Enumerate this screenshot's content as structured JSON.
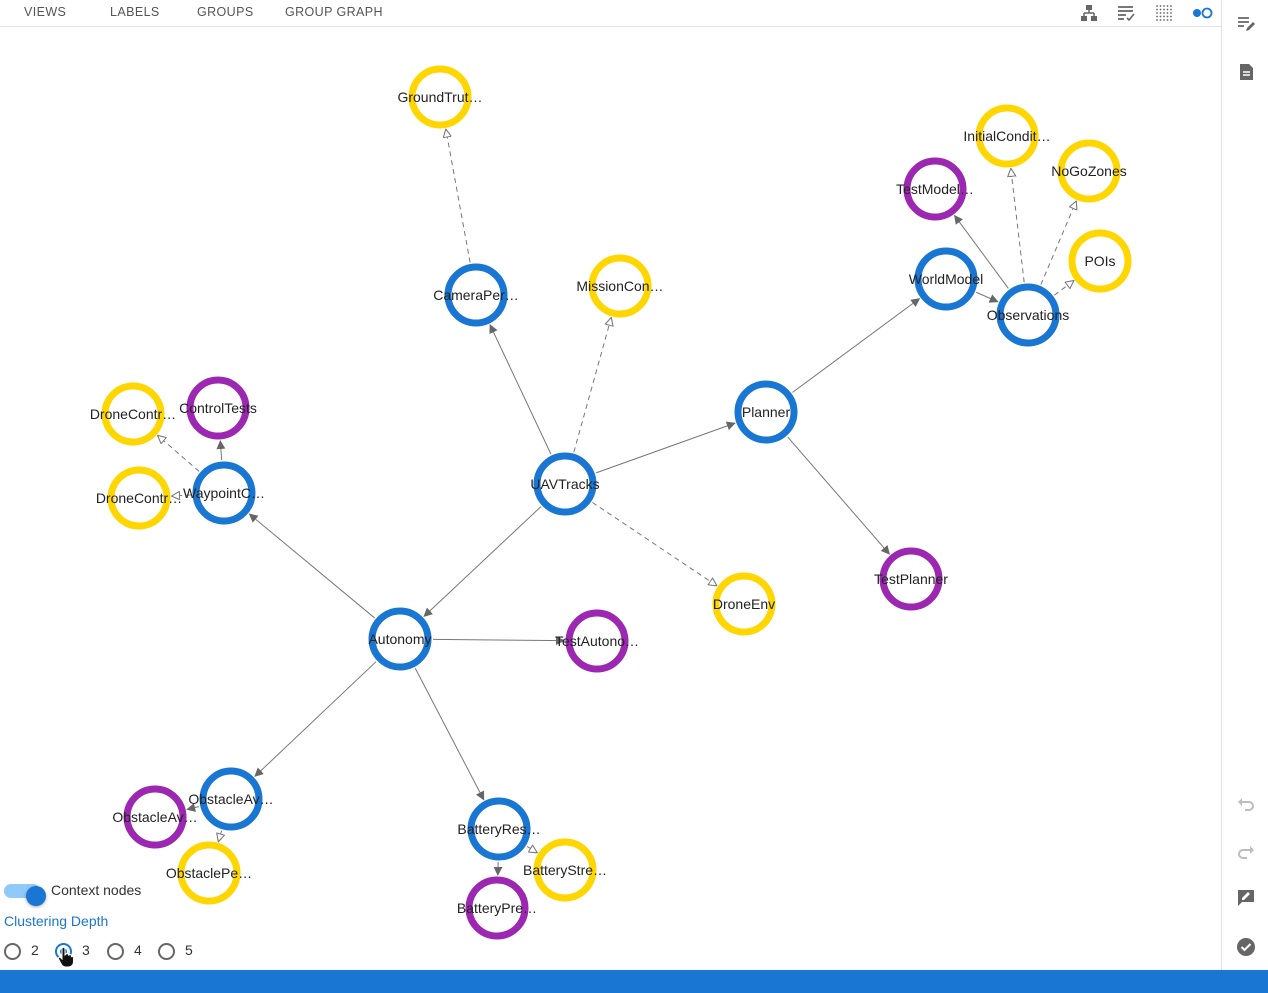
{
  "tabs": [
    "VIEWS",
    "LABELS",
    "GROUPS",
    "GROUP GRAPH"
  ],
  "toolbar_icons": [
    "hierarchy-icon",
    "list-check-icon",
    "dot-grid-icon",
    "node-toggle-icon"
  ],
  "sidebar_icons": [
    "edit-list-icon",
    "document-icon",
    "undo-icon",
    "redo-icon",
    "feedback-icon",
    "check-circle-icon"
  ],
  "colors": {
    "blue": "#1976d2",
    "yellow": "#ffd600",
    "purple": "#9c27b0",
    "accent": "#1976d2",
    "bottom_bar": "#1976d2",
    "toggle_track": "#90caf9",
    "edge": "#777777"
  },
  "graph": {
    "nodes": [
      {
        "id": "uav",
        "label": "UAVTracks",
        "color": "blue"
      },
      {
        "id": "planner",
        "label": "Planner",
        "color": "blue"
      },
      {
        "id": "autonomy",
        "label": "Autonomy",
        "color": "blue"
      },
      {
        "id": "camera",
        "label": "CameraPer…",
        "color": "blue"
      },
      {
        "id": "mission",
        "label": "MissionCon…",
        "color": "yellow"
      },
      {
        "id": "ground",
        "label": "GroundTrut…",
        "color": "yellow"
      },
      {
        "id": "droneenv",
        "label": "DroneEnv",
        "color": "yellow"
      },
      {
        "id": "testplanner",
        "label": "TestPlanner",
        "color": "purple"
      },
      {
        "id": "worldmodel",
        "label": "WorldModel",
        "color": "blue"
      },
      {
        "id": "observations",
        "label": "Observations",
        "color": "blue"
      },
      {
        "id": "testmodel",
        "label": "TestModel…",
        "color": "purple"
      },
      {
        "id": "initialcond",
        "label": "InitialCondit…",
        "color": "yellow"
      },
      {
        "id": "nogozones",
        "label": "NoGoZones",
        "color": "yellow"
      },
      {
        "id": "pois",
        "label": "POIs",
        "color": "yellow"
      },
      {
        "id": "waypoint",
        "label": "WaypointC…",
        "color": "blue"
      },
      {
        "id": "dronecontr1",
        "label": "DroneContr…",
        "color": "yellow"
      },
      {
        "id": "controltests",
        "label": "ControlTests",
        "color": "purple"
      },
      {
        "id": "dronecontr2",
        "label": "DroneContr…",
        "color": "yellow"
      },
      {
        "id": "testautono",
        "label": "TestAutono…",
        "color": "purple"
      },
      {
        "id": "obstacleav",
        "label": "ObstacleAv…",
        "color": "blue"
      },
      {
        "id": "obstacleav2",
        "label": "ObstacleAv…",
        "color": "purple"
      },
      {
        "id": "obstaclepe",
        "label": "ObstaclePe…",
        "color": "yellow"
      },
      {
        "id": "batteryres",
        "label": "BatteryRes…",
        "color": "blue"
      },
      {
        "id": "batterystre",
        "label": "BatteryStre…",
        "color": "yellow"
      },
      {
        "id": "batterypre",
        "label": "BatteryPre…",
        "color": "purple"
      }
    ],
    "edges": [
      {
        "from": "uav",
        "to": "planner",
        "dashed": false
      },
      {
        "from": "uav",
        "to": "camera",
        "dashed": false
      },
      {
        "from": "uav",
        "to": "mission",
        "dashed": true
      },
      {
        "from": "uav",
        "to": "droneenv",
        "dashed": true
      },
      {
        "from": "uav",
        "to": "autonomy",
        "dashed": false
      },
      {
        "from": "camera",
        "to": "ground",
        "dashed": true
      },
      {
        "from": "planner",
        "to": "worldmodel",
        "dashed": false
      },
      {
        "from": "planner",
        "to": "testplanner",
        "dashed": false
      },
      {
        "from": "worldmodel",
        "to": "observations",
        "dashed": false
      },
      {
        "from": "observations",
        "to": "testmodel",
        "dashed": false
      },
      {
        "from": "observations",
        "to": "initialcond",
        "dashed": true
      },
      {
        "from": "observations",
        "to": "nogozones",
        "dashed": true
      },
      {
        "from": "observations",
        "to": "pois",
        "dashed": true
      },
      {
        "from": "autonomy",
        "to": "waypoint",
        "dashed": false
      },
      {
        "from": "autonomy",
        "to": "testautono",
        "dashed": false
      },
      {
        "from": "autonomy",
        "to": "obstacleav",
        "dashed": false
      },
      {
        "from": "autonomy",
        "to": "batteryres",
        "dashed": false
      },
      {
        "from": "waypoint",
        "to": "dronecontr1",
        "dashed": true
      },
      {
        "from": "waypoint",
        "to": "controltests",
        "dashed": false
      },
      {
        "from": "waypoint",
        "to": "dronecontr2",
        "dashed": true
      },
      {
        "from": "obstacleav",
        "to": "obstacleav2",
        "dashed": false
      },
      {
        "from": "obstacleav",
        "to": "obstaclepe",
        "dashed": true
      },
      {
        "from": "batteryres",
        "to": "batterystre",
        "dashed": true
      },
      {
        "from": "batteryres",
        "to": "batterypre",
        "dashed": false
      }
    ]
  },
  "controls": {
    "context_nodes_label": "Context nodes",
    "context_nodes_on": true,
    "clustering_label": "Clustering Depth",
    "depth_options": [
      "2",
      "3",
      "4",
      "5"
    ],
    "depth_selected": "3"
  }
}
